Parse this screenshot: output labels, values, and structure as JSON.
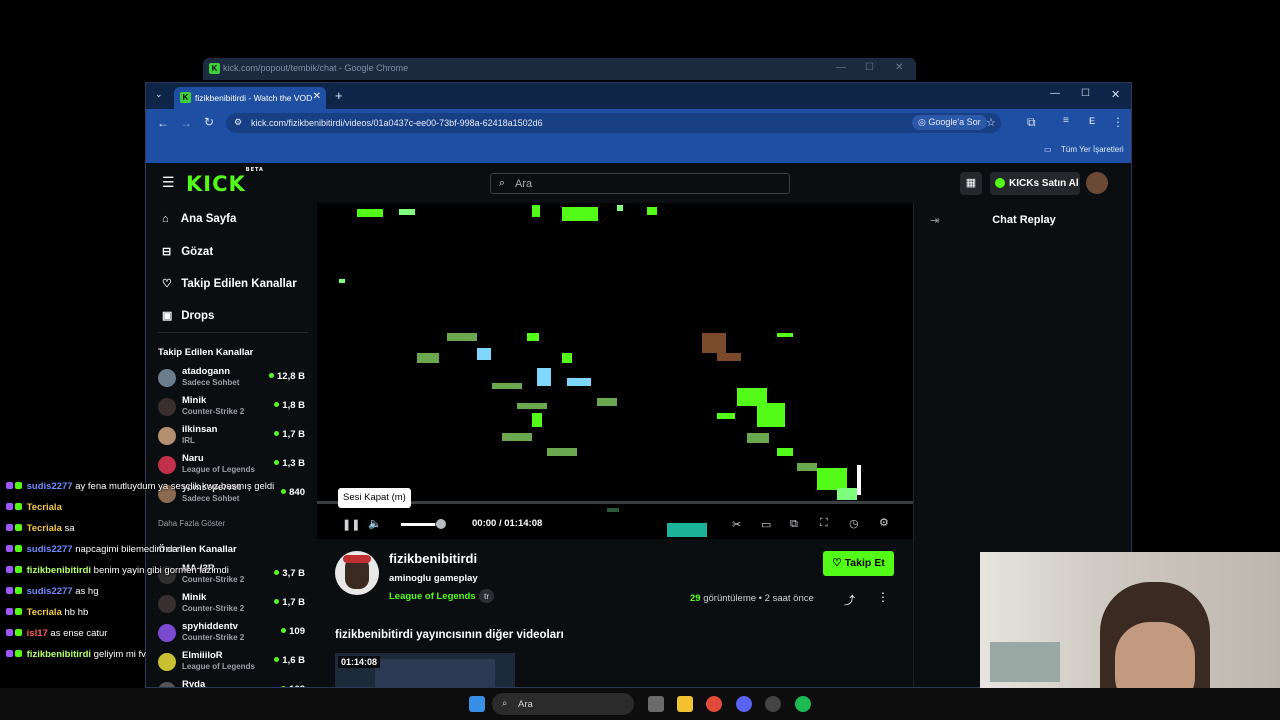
{
  "bg_window": {
    "title": "kick.com/popout/tembik/chat - Google Chrome"
  },
  "browser": {
    "tab_title": "fizikbenibitirdi - Watch the VOD",
    "url": "kick.com/fizikbenibitirdi/videos/01a0437c-ee00-73bf-998a-62418a1502d6",
    "ask_google": "Google'a Sor",
    "profile_letter": "E",
    "all_bookmarks": "Tüm Yer İşaretleri"
  },
  "kick": {
    "logo": "KICK",
    "logo_badge": "BETA",
    "search_placeholder": "Ara",
    "kicks_button": "KICKs Satın Al",
    "nav": [
      {
        "label": "Ana Sayfa",
        "icon": "home-icon"
      },
      {
        "label": "Gözat",
        "icon": "browse-icon"
      },
      {
        "label": "Takip Edilen Kanallar",
        "icon": "heart-icon"
      },
      {
        "label": "Drops",
        "icon": "gift-icon"
      }
    ],
    "followed_title": "Takip Edilen Kanallar",
    "followed": [
      {
        "name": "atadogann",
        "game": "Sadece Sohbet",
        "viewers": "12,8 B",
        "color": "#6a7d8c"
      },
      {
        "name": "Minik",
        "game": "Counter-Strike 2",
        "viewers": "1,8 B",
        "color": "#3a2f2f"
      },
      {
        "name": "ilkinsan",
        "game": "IRL",
        "viewers": "1,7 B",
        "color": "#b39070"
      },
      {
        "name": "Naru",
        "game": "League of Legends",
        "viewers": "1,3 B",
        "color": "#c0304a"
      },
      {
        "name": "yomsepervet",
        "game": "Sadece Sohbet",
        "viewers": "840",
        "color": "#8a6a50"
      }
    ],
    "show_more": "Daha Fazla Göster",
    "recommended_title": "Önerilen Kanallar",
    "recommended": [
      {
        "name": "MA-I3R",
        "game": "Counter-Strike 2",
        "viewers": "3,7 B",
        "color": "#2f2f2f"
      },
      {
        "name": "Minik",
        "game": "Counter-Strike 2",
        "viewers": "1,7 B",
        "color": "#3a2f2f"
      },
      {
        "name": "spyhiddentv",
        "game": "Counter-Strike 2",
        "viewers": "109",
        "color": "#7a4ad0"
      },
      {
        "name": "ElmiiiloR",
        "game": "League of Legends",
        "viewers": "1,6 B",
        "color": "#c8c030"
      },
      {
        "name": "Ryda",
        "game": "",
        "viewers": "162",
        "color": "#555"
      }
    ],
    "player": {
      "tooltip": "Sesi Kapat (m)",
      "time_current": "00:00",
      "time_total": "01:14:08",
      "volume_level": 0.85
    },
    "chat_replay_title": "Chat Replay",
    "streamer": {
      "name": "fizikbenibitirdi",
      "title": "aminoglu gameplay",
      "category": "League of Legends",
      "language": "tr",
      "follow_button": "Takip Et",
      "views_count": "29",
      "views_label": "görüntüleme",
      "ago": "2 saat önce"
    },
    "other_videos_title": "fizikbenibitirdi yayıncısının diğer videoları",
    "thumb_duration": "01:14:08"
  },
  "overlay_chat": [
    {
      "user": "sudis2277",
      "msg": "ay fena mutluydum ya sesçlik kwz basmış geldi",
      "color": "#6f8cff"
    },
    {
      "user": "Tecriala",
      "msg": "",
      "color": "#f2c94c"
    },
    {
      "user": "Tecriala",
      "msg": "sa",
      "color": "#f2c94c"
    },
    {
      "user": "sudis2277",
      "msg": "napcagimi bilemedim da",
      "color": "#6f8cff"
    },
    {
      "user": "fizikbenibitirdi",
      "msg": "benim yayin gibi gormen lazimdi",
      "color": "#b4ff6a"
    },
    {
      "user": "sudis2277",
      "msg": "as hg",
      "color": "#6f8cff"
    },
    {
      "user": "Tecriala",
      "msg": "hb hb",
      "color": "#f2c94c"
    },
    {
      "user": "isl17",
      "msg": "as ense catur",
      "color": "#ff5a5a"
    },
    {
      "user": "fizikbenibitirdi",
      "msg": "geliyim mi fv",
      "color": "#b4ff6a"
    }
  ],
  "taskbar": {
    "search": "Ara"
  }
}
